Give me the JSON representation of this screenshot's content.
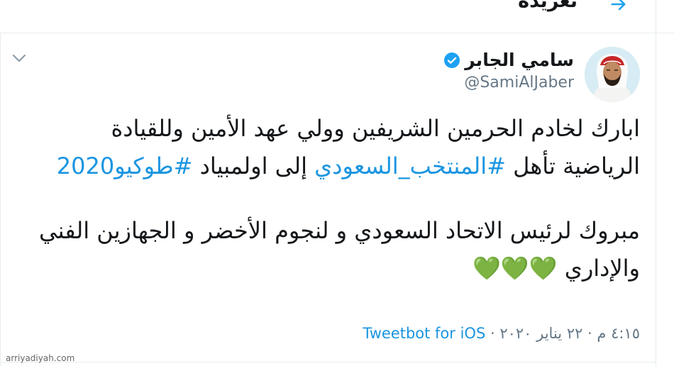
{
  "header": {
    "title": "تغريدة",
    "back_icon": "arrow-right-icon"
  },
  "tweet": {
    "author": {
      "display_name": "سامي الجابر",
      "handle": "@SamiAlJaber",
      "verified_icon": "verified-badge-icon"
    },
    "more_icon": "chevron-down-icon",
    "text": {
      "p1_plain": "ابارك لخادم الحرمين الشريفين وولي عهد الأمين وللقيادة الرياضية تأهل ",
      "hashtag_1": "#المنتخب_السعودي",
      "p1_after": " إلى اولمبياد ",
      "hashtag_2": "#طوكيو2020",
      "p2_plain": "مبروك لرئيس الاتحاد السعودي و  لنجوم الأخضر و الجهازين الفني والإداري ",
      "hearts": "💚💚💚"
    },
    "timestamp": "٤:١٥ م · ٢٢ يناير ٢٠٢٠ · ",
    "via": "Tweetbot for iOS"
  },
  "watermark": "arriyadiyah.com",
  "colors": {
    "accent": "#1da1f2",
    "link": "#1b95e0",
    "muted": "#657786",
    "border": "#e6ecf0",
    "heart": "#77b255"
  }
}
